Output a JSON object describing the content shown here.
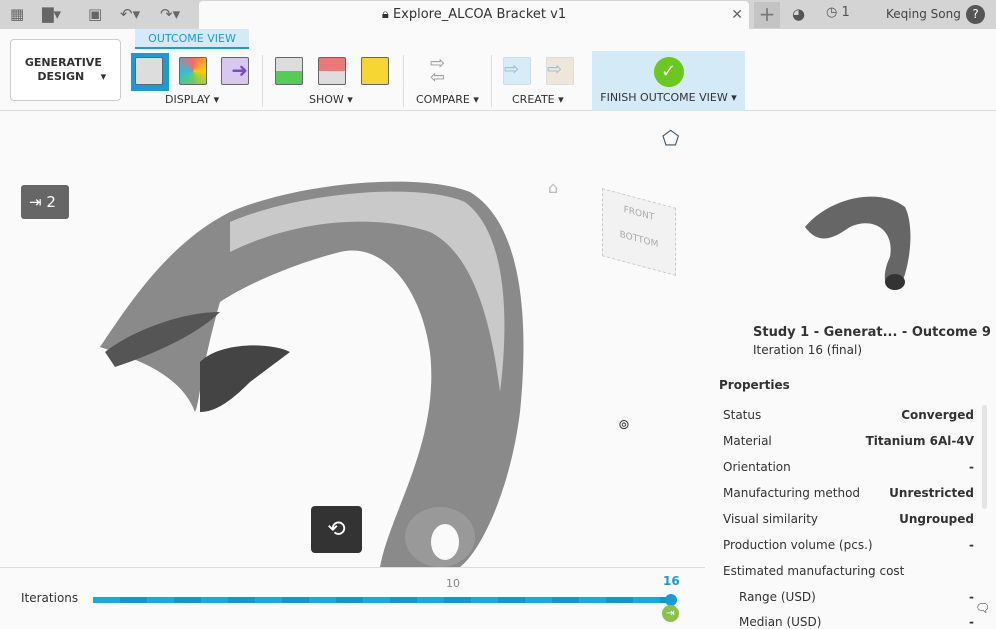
{
  "topbar": {
    "title": "Explore_ALCOA Bracket v1",
    "jobs_count": "1",
    "user": "Keqing Song"
  },
  "ribbon": {
    "workspace": "GENERATIVE DESIGN",
    "tab": "OUTCOME VIEW",
    "groups": {
      "display": "DISPLAY",
      "show": "SHOW",
      "compare": "COMPARE",
      "create": "CREATE",
      "finish": "FINISH OUTCOME VIEW"
    }
  },
  "viewport": {
    "badge_count": "2",
    "viewcube": {
      "front": "FRONT",
      "bottom": "BOTTOM"
    }
  },
  "outcome": {
    "title": "Study 1 - Generat... - Outcome 9",
    "subtitle": "Iteration 16 (final)",
    "properties_heading": "Properties",
    "properties": [
      {
        "label": "Status",
        "value": "Converged"
      },
      {
        "label": "Material",
        "value": "Titanium 6Al-4V"
      },
      {
        "label": "Orientation",
        "value": "-"
      },
      {
        "label": "Manufacturing method",
        "value": "Unrestricted"
      },
      {
        "label": "Visual similarity",
        "value": "Ungrouped"
      },
      {
        "label": "Production volume (pcs.)",
        "value": "-"
      },
      {
        "label": "Estimated manufacturing cost",
        "value": ""
      },
      {
        "label": "Range (USD)",
        "value": "-"
      },
      {
        "label": "Median (USD)",
        "value": "-"
      }
    ]
  },
  "iterations": {
    "label": "Iterations",
    "tick": "10",
    "current": "16",
    "progress": 1.0
  }
}
